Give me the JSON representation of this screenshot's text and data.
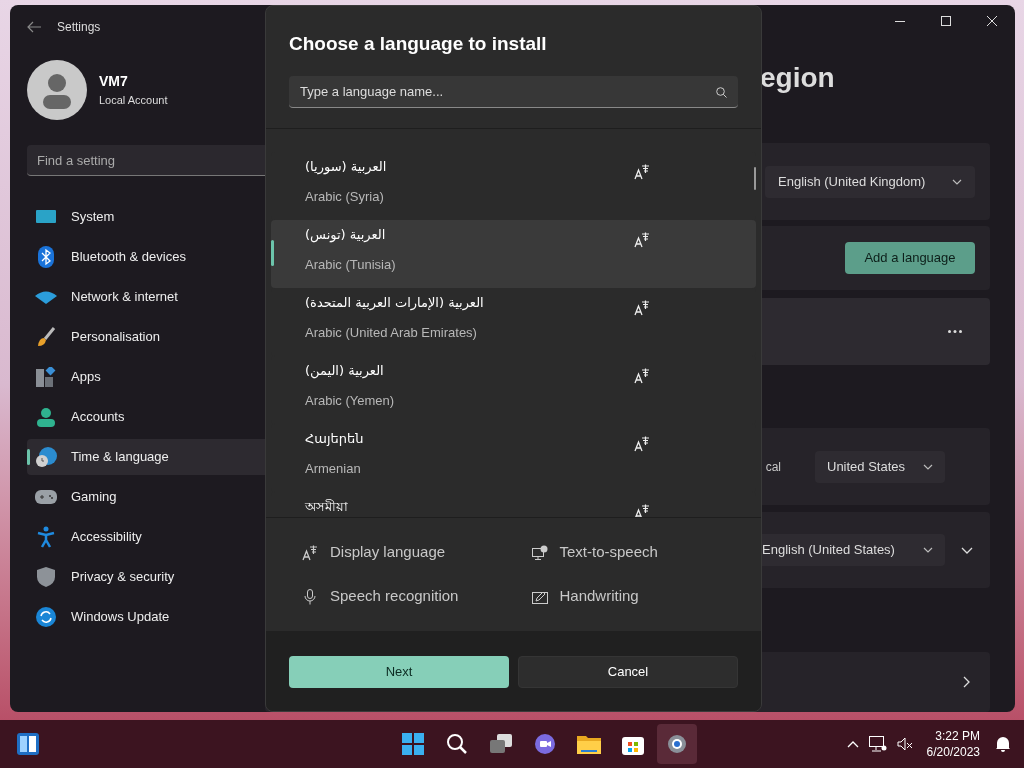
{
  "window": {
    "title": "Settings"
  },
  "account": {
    "name": "VM7",
    "type": "Local Account"
  },
  "search": {
    "placeholder": "Find a setting"
  },
  "nav": [
    {
      "label": "System",
      "selected": false
    },
    {
      "label": "Bluetooth & devices",
      "selected": false
    },
    {
      "label": "Network & internet",
      "selected": false
    },
    {
      "label": "Personalisation",
      "selected": false
    },
    {
      "label": "Apps",
      "selected": false
    },
    {
      "label": "Accounts",
      "selected": false
    },
    {
      "label": "Time & language",
      "selected": true
    },
    {
      "label": "Gaming",
      "selected": false
    },
    {
      "label": "Accessibility",
      "selected": false
    },
    {
      "label": "Privacy & security",
      "selected": false
    },
    {
      "label": "Windows Update",
      "selected": false
    }
  ],
  "page": {
    "title": "egion",
    "language_dropdown": "English (United Kingdom)",
    "add_button": "Add a language",
    "region_label": "cal",
    "region_dropdown": "United States",
    "format_dropdown": "English (United States)"
  },
  "dialog": {
    "title": "Choose a language to install",
    "search_placeholder": "Type a language name...",
    "languages": [
      {
        "native": "العربية (سوريا)",
        "english": "Arabic (Syria)",
        "selected": false
      },
      {
        "native": "العربية (تونس)",
        "english": "Arabic (Tunisia)",
        "selected": true
      },
      {
        "native": "العربية (الإمارات العربية المتحدة)",
        "english": "Arabic (United Arab Emirates)",
        "selected": false
      },
      {
        "native": "العربية (اليمن)",
        "english": "Arabic (Yemen)",
        "selected": false
      },
      {
        "native": "Հայերեն",
        "english": "Armenian",
        "selected": false
      },
      {
        "native": "অসমীয়া",
        "selected": false
      }
    ],
    "features": [
      "Display language",
      "Text-to-speech",
      "Speech recognition",
      "Handwriting"
    ],
    "buttons": [
      "Next",
      "Cancel"
    ]
  },
  "taskbar": {
    "time": "3:22 PM",
    "date": "6/20/2023"
  }
}
